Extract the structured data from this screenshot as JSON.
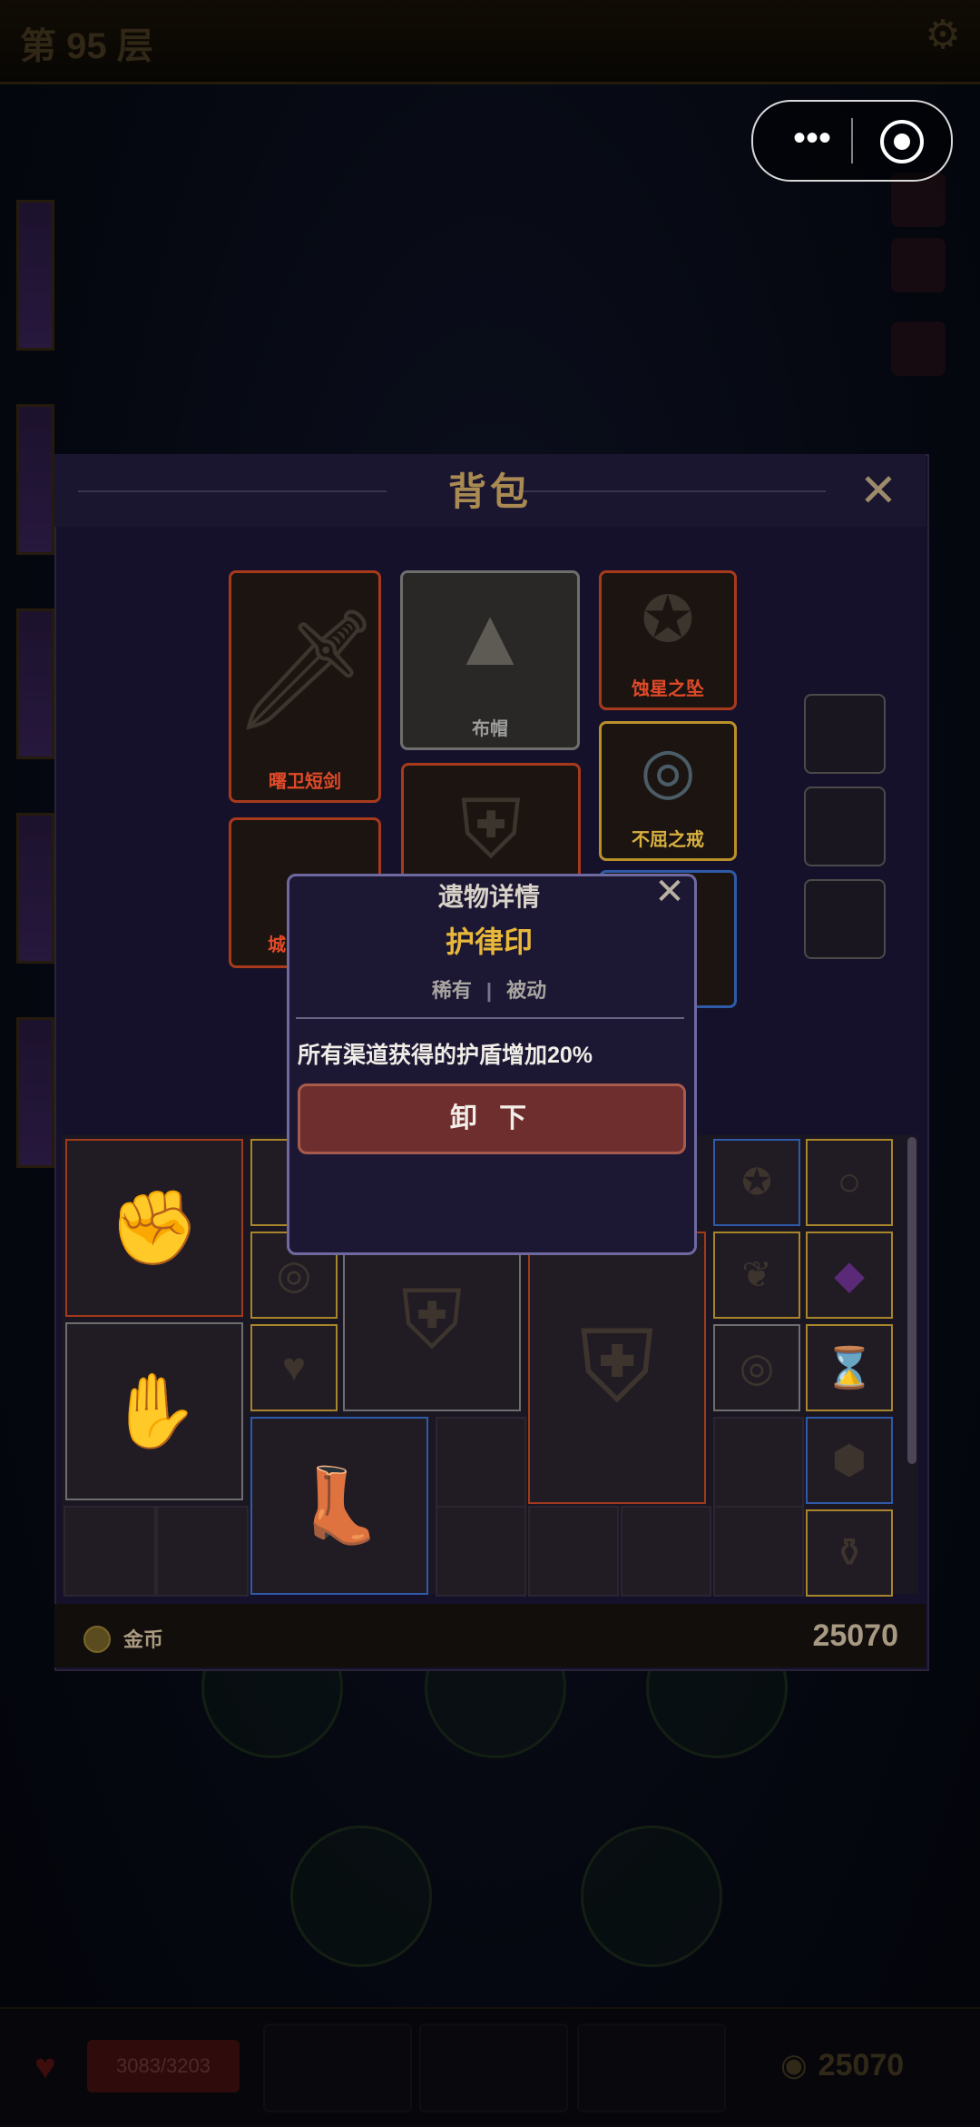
{
  "header": {
    "floor": "第 95 层"
  },
  "bottom_bar": {
    "hp": "3083/3203",
    "gold": "25070"
  },
  "backpack": {
    "title": "背包",
    "equipped": [
      {
        "label": "曙卫短剑",
        "color": "#e04a2a"
      },
      {
        "label": "布帽",
        "color": "#9c9c9c"
      },
      {
        "label": "蚀星之坠",
        "color": "#e04a2a"
      },
      {
        "label": "不屈之戒",
        "color": "#d8b040"
      },
      {
        "label": "城",
        "color": "#e04a2a"
      }
    ],
    "gold_label": "金币",
    "gold_value": "25070"
  },
  "relic_modal": {
    "title": "遗物详情",
    "name": "护律印",
    "rarity": "稀有",
    "separator": "|",
    "kind": "被动",
    "description": "所有渠道获得的护盾增加20%",
    "unequip_label": "卸 下"
  },
  "icons": {
    "gear": "gear-icon",
    "menu": "more-dots-icon",
    "close": "close-icon",
    "coin": "coin-icon",
    "heart": "heart-icon"
  }
}
